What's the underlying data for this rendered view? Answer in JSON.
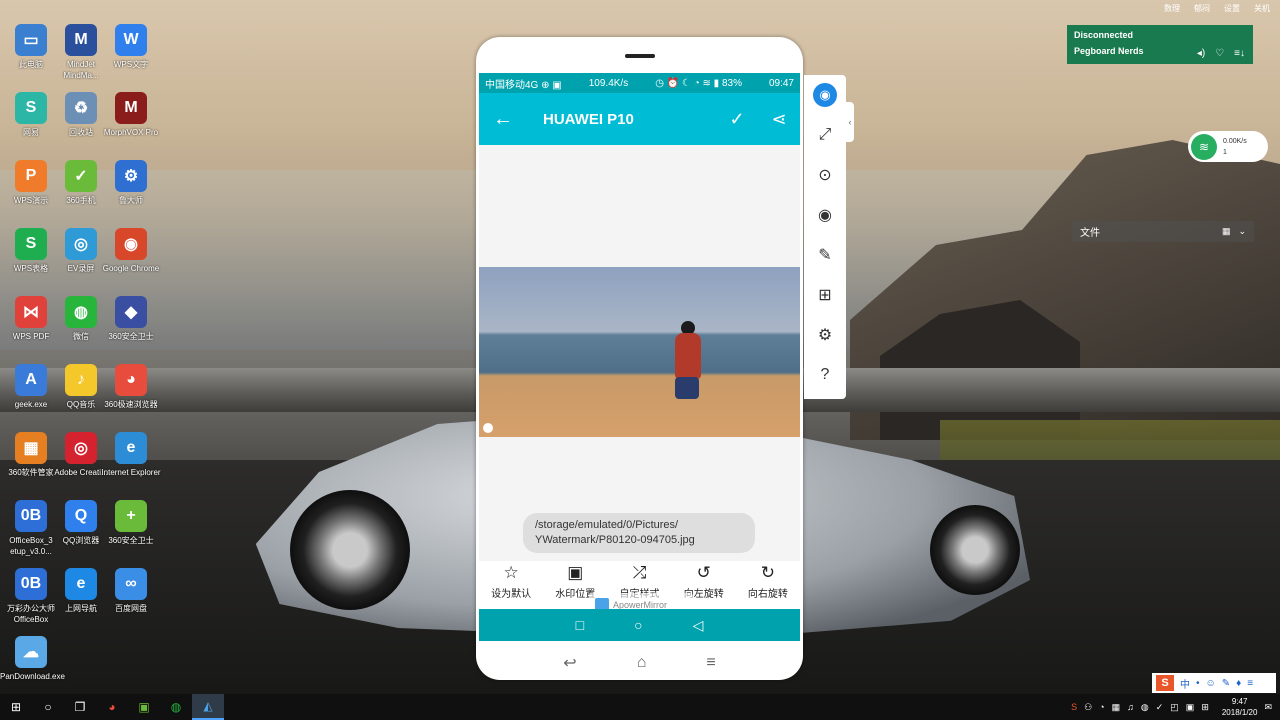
{
  "desktop": {
    "icons": [
      {
        "label": "此电脑",
        "glyph": "▭",
        "color": "#3b7fd1"
      },
      {
        "label": "MindJet MindMa...",
        "glyph": "M",
        "color": "#2a4f9c"
      },
      {
        "label": "WPS文字",
        "glyph": "W",
        "color": "#2f80ed"
      },
      {
        "label": "网易",
        "glyph": "S",
        "color": "#2cb6a6"
      },
      {
        "label": "回收站",
        "glyph": "♻",
        "color": "#6c8fb5"
      },
      {
        "label": "MorphVOX Pro",
        "glyph": "M",
        "color": "#8b1c1c"
      },
      {
        "label": "WPS演示",
        "glyph": "P",
        "color": "#f07b2a"
      },
      {
        "label": "360手机",
        "glyph": "✓",
        "color": "#6bbb3a"
      },
      {
        "label": "鲁大师",
        "glyph": "⚙",
        "color": "#2e6fd1"
      },
      {
        "label": "WPS表格",
        "glyph": "S",
        "color": "#1fae4f"
      },
      {
        "label": "EV录屏",
        "glyph": "◎",
        "color": "#2e9ad6"
      },
      {
        "label": "Google Chrome",
        "glyph": "◉",
        "color": "#d9472b"
      },
      {
        "label": "WPS PDF",
        "glyph": "⋈",
        "color": "#e0413b"
      },
      {
        "label": "微信",
        "glyph": "◍",
        "color": "#28b53c"
      },
      {
        "label": "360安全卫士",
        "glyph": "◆",
        "color": "#3b4fa2"
      },
      {
        "label": "geek.exe",
        "glyph": "A",
        "color": "#3a7ad9"
      },
      {
        "label": "QQ音乐",
        "glyph": "♪",
        "color": "#f4c72a"
      },
      {
        "label": "360极速浏览器",
        "glyph": "◕",
        "color": "#e74c3c"
      },
      {
        "label": "360软件管家",
        "glyph": "▦",
        "color": "#e67e22"
      },
      {
        "label": "Adobe Creati...",
        "glyph": "◎",
        "color": "#d4232e"
      },
      {
        "label": "Internet Explorer",
        "glyph": "e",
        "color": "#2d8cd6"
      },
      {
        "label": "OfficeBox_3 etup_v3.0...",
        "glyph": "0B",
        "color": "#2d6fd6"
      },
      {
        "label": "QQ浏览器",
        "glyph": "Q",
        "color": "#2f80ed"
      },
      {
        "label": "360安全卫士",
        "glyph": "+",
        "color": "#6bbb3a"
      },
      {
        "label": "万彩办公大师OfficeBox",
        "glyph": "0B",
        "color": "#2d6fd6"
      },
      {
        "label": "上网导航",
        "glyph": "e",
        "color": "#1e88e5"
      },
      {
        "label": "百度网盘",
        "glyph": "∞",
        "color": "#3a8ee6"
      },
      {
        "label": "PanDownload.exe",
        "glyph": "☁",
        "color": "#5aa9e6"
      }
    ]
  },
  "phone": {
    "status_left": "中国移动4G ⊕ ▣",
    "status_speed": "109.4K/s",
    "status_icons": "◷ ⏰ ☾ ◔ ≋ ▮ 83%",
    "status_time": "09:47",
    "app_title": "HUAWEI P10",
    "back_icon": "←",
    "check_icon": "✓",
    "share_icon": "⋖",
    "file_path_line1": "/storage/emulated/0/Pictures/",
    "file_path_line2": "YWatermark/P80120-094705.jpg",
    "watermark_text": "ApowerMirror",
    "tools": [
      {
        "label": "设为默认",
        "icon": "☆"
      },
      {
        "label": "水印位置",
        "icon": "▣"
      },
      {
        "label": "自定样式",
        "icon": "⤮"
      },
      {
        "label": "向左旋转",
        "icon": "↺"
      },
      {
        "label": "向右旋转",
        "icon": "↻"
      }
    ],
    "nav_square": "□",
    "nav_home": "○",
    "nav_back": "◁",
    "hw_back": "↩",
    "hw_home": "⌂",
    "hw_menu": "≡"
  },
  "sidebar": {
    "avatar": "◉",
    "fullscreen": "⤢",
    "screenshot": "⊙",
    "record": "◉",
    "pen": "✎",
    "gift": "⊞",
    "settings": "⚙",
    "help": "?",
    "collapse": "‹"
  },
  "music_widget": {
    "status": "Disconnected",
    "source": "Pegboard Nerds",
    "controls": [
      "◂)",
      "♡",
      "≡↓"
    ]
  },
  "top_strip": [
    "数理",
    "郁闷",
    "设置",
    "关机"
  ],
  "net_widget": {
    "speed": "0.00K/s",
    "count": "1"
  },
  "file_panel": {
    "label": "文件",
    "view_icon": "▦",
    "dropdown_icon": "⌄"
  },
  "taskbar": {
    "time": "9:47",
    "date": "2018/1/20",
    "tray_icons": [
      "S",
      "⚇",
      "◔",
      "▦",
      "♫",
      "◍",
      "✓",
      "◰",
      "▣",
      "⊞",
      "✉"
    ]
  },
  "ime": {
    "brand": "S",
    "items": [
      "中",
      "•",
      "☺",
      "✎",
      "♦",
      "≡"
    ]
  }
}
